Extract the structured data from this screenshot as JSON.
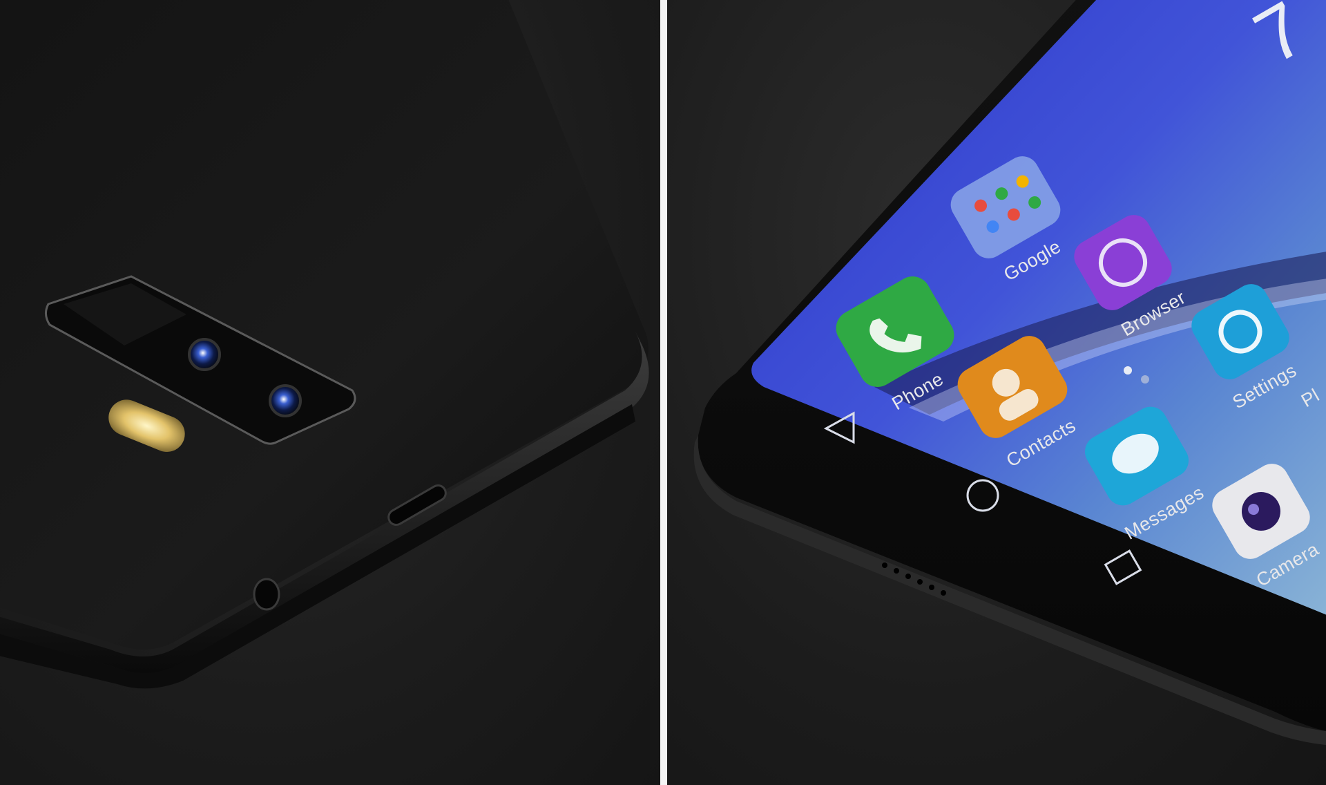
{
  "scene": {
    "description_left": "Rear of a black smartphone with dual camera, flash, USB port and headphone jack",
    "description_right": "Front of the smartphone showing home screen icons"
  },
  "home_screen": {
    "clock_digit": "7",
    "apps": [
      {
        "label": "Google",
        "icon": "google-folder-icon",
        "color": "#8aa6e8"
      },
      {
        "label": "Browser",
        "icon": "browser-globe-icon",
        "color": "#8a3fd6"
      },
      {
        "label": "Phone",
        "icon": "phone-handset-icon",
        "color": "#2fa944"
      },
      {
        "label": "Settings",
        "icon": "settings-gear-icon",
        "color": "#1e9fd8"
      },
      {
        "label": "Contacts",
        "icon": "contacts-person-icon",
        "color": "#e08a1c"
      },
      {
        "label": "Messages",
        "icon": "messages-bubble-icon",
        "color": "#1ea6d8"
      },
      {
        "label": "Camera",
        "icon": "camera-lens-icon",
        "color": "#e8e8ec"
      },
      {
        "label": "Pl",
        "icon": "play-store-icon",
        "color": "#ffffff"
      }
    ],
    "nav": {
      "back": "back-triangle-icon",
      "home": "home-circle-icon",
      "recents": "recents-square-icon"
    }
  },
  "colors": {
    "background": "#1e1e1e",
    "divider": "#f4f4f4",
    "screen_blue": "#3a4ad8"
  }
}
